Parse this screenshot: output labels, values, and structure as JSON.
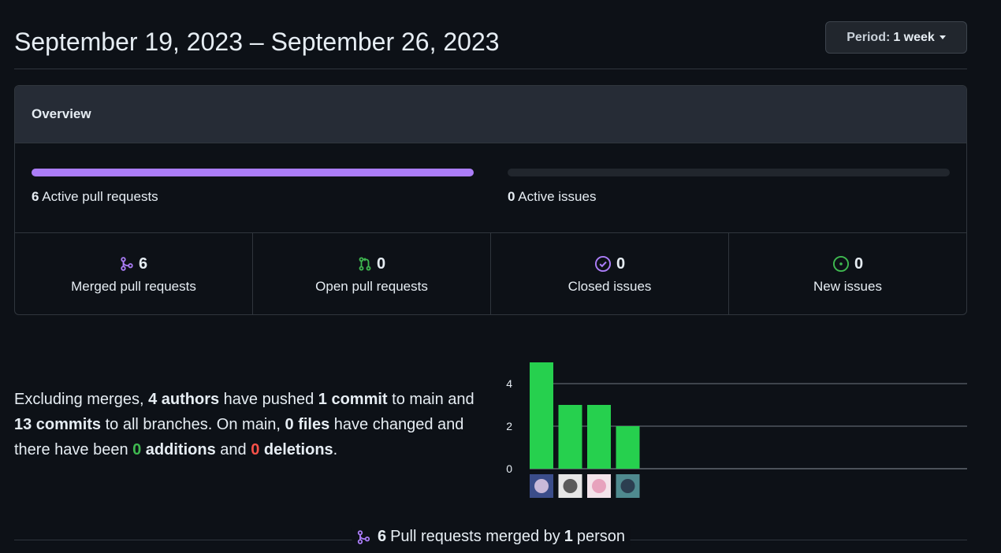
{
  "header": {
    "date_range": "September 19, 2023 – September 26, 2023",
    "period_label": "Period:",
    "period_value": "1 week"
  },
  "overview": {
    "title": "Overview",
    "active_prs": {
      "count": "6",
      "label": "Active pull requests",
      "fill_fraction": 1.0
    },
    "active_issues": {
      "count": "0",
      "label": "Active issues",
      "fill_fraction": 0
    },
    "stats": [
      {
        "icon": "git-merge-icon",
        "count": "6",
        "label": "Merged pull requests",
        "color": "#ab7df8"
      },
      {
        "icon": "git-pull-request-icon",
        "count": "0",
        "label": "Open pull requests",
        "color": "#3fb950"
      },
      {
        "icon": "issue-closed-icon",
        "count": "0",
        "label": "Closed issues",
        "color": "#ab7df8"
      },
      {
        "icon": "issue-opened-icon",
        "count": "0",
        "label": "New issues",
        "color": "#3fb950"
      }
    ]
  },
  "summary": {
    "t1": "Excluding merges, ",
    "authors": "4 authors",
    "t2": " have pushed ",
    "commit_main": "1 commit",
    "t3": " to main and ",
    "commits_all": "13 commits",
    "t4": " to all branches. On main, ",
    "files": "0 files",
    "t5": " have changed and there have been ",
    "additions_num": "0",
    "additions_word": " additions",
    "t6": " and ",
    "deletions_num": "0",
    "deletions_word": " deletions",
    "t7": "."
  },
  "chart_data": {
    "type": "bar",
    "categories": [
      "author-1",
      "author-2",
      "author-3",
      "author-4"
    ],
    "values": [
      5,
      3,
      3,
      2
    ],
    "yticks": [
      0,
      2,
      4
    ],
    "ylim": [
      0,
      5
    ],
    "bar_color": "#26d04e",
    "grid": true
  },
  "footer": {
    "count": "6",
    "text1": "Pull requests merged by",
    "people": "1",
    "text2": "person"
  },
  "colors": {
    "accent_purple": "#ab7df8",
    "accent_green": "#3fb950",
    "accent_red": "#f85149"
  }
}
